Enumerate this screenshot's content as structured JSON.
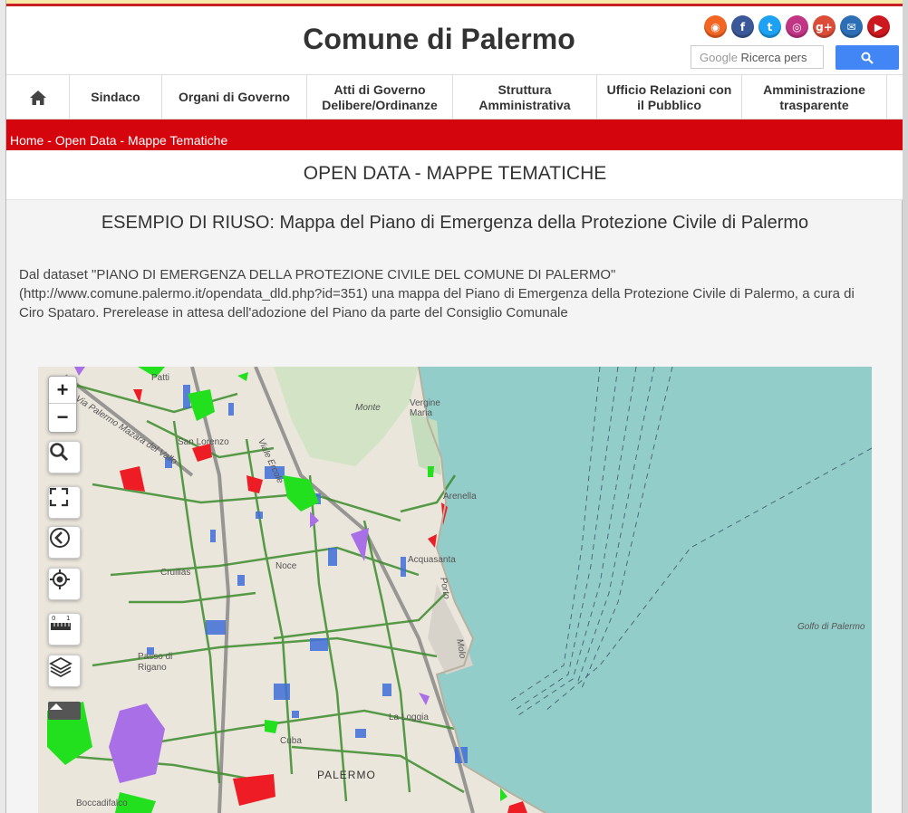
{
  "header": {
    "title": "Comune di Palermo",
    "search": {
      "logo_text": "Google",
      "placeholder": "Ricerca pers"
    },
    "social_icons": [
      {
        "name": "rss-icon",
        "color": "#f26522",
        "glyph": "◉"
      },
      {
        "name": "facebook-icon",
        "color": "#3b5998",
        "glyph": "f"
      },
      {
        "name": "twitter-icon",
        "color": "#1da1f2",
        "glyph": "t"
      },
      {
        "name": "instagram-icon",
        "color": "#c13584",
        "glyph": "◎"
      },
      {
        "name": "googleplus-icon",
        "color": "#dd4b39",
        "glyph": "g+"
      },
      {
        "name": "email-icon",
        "color": "#2d6fb6",
        "glyph": "✉"
      },
      {
        "name": "youtube-icon",
        "color": "#cc181e",
        "glyph": "▶"
      }
    ]
  },
  "nav": {
    "home_icon": "home-icon",
    "items": [
      {
        "label": "Sindaco"
      },
      {
        "label": "Organi di Governo"
      },
      {
        "label": "Atti di Governo\nDelibere/Ordinanze"
      },
      {
        "label": "Struttura\nAmministrativa"
      },
      {
        "label": "Ufficio Relazioni con\nil Pubblico"
      },
      {
        "label": "Amministrazione\ntrasparente"
      }
    ]
  },
  "breadcrumb": {
    "home": "Home",
    "sep1": " - ",
    "open_data": "Open Data",
    "sep2": " - ",
    "current": "Mappe Tematiche"
  },
  "page": {
    "title": "OPEN DATA - MAPPE TEMATICHE",
    "subtitle": "ESEMPIO DI RIUSO: Mappa del Piano di Emergenza della Protezione Civile di Palermo",
    "description": "Dal dataset \"PIANO DI EMERGENZA DELLA PROTEZIONE CIVILE DEL COMUNE DI PALERMO\" (http://www.comune.palermo.it/opendata_dld.php?id=351) una mappa del Piano di Emergenza della Protezione Civile di Palermo, a cura di Ciro Spataro. Prerelease in attesa dell'adozione del Piano da parte del Consiglio Comunale"
  },
  "map": {
    "zoom_in": "+",
    "zoom_out": "−",
    "labels": {
      "patti": "Patti",
      "san_lorenzo": "San Lorenzo",
      "monte": "Monte",
      "vergine_maria": "Vergine\nMaria",
      "arenella": "Arenella",
      "acquasanta": "Acquasanta",
      "cruillas": "Cruillas",
      "noce": "Noce",
      "passo_di_rigano": "Passo di\nRigano",
      "golfo": "Golfo di Palermo",
      "la_loggia": "La Loggia",
      "cuba": "Cuba",
      "palermo": "PALERMO",
      "boccadifalco": "Boccadifalco",
      "viale_ercole": "Viale Ercole",
      "viale_mazara": "Via Palermo Mazara del Vallo",
      "porto": "Porto",
      "molo": "Molo"
    },
    "colors": {
      "sea": "#93cdc9",
      "land": "#ece7dd",
      "green": "#22e01e",
      "blue": "#3f6fd8",
      "purple": "#a86fe6",
      "red": "#ee1c25",
      "route": "#3c8c2c"
    }
  }
}
